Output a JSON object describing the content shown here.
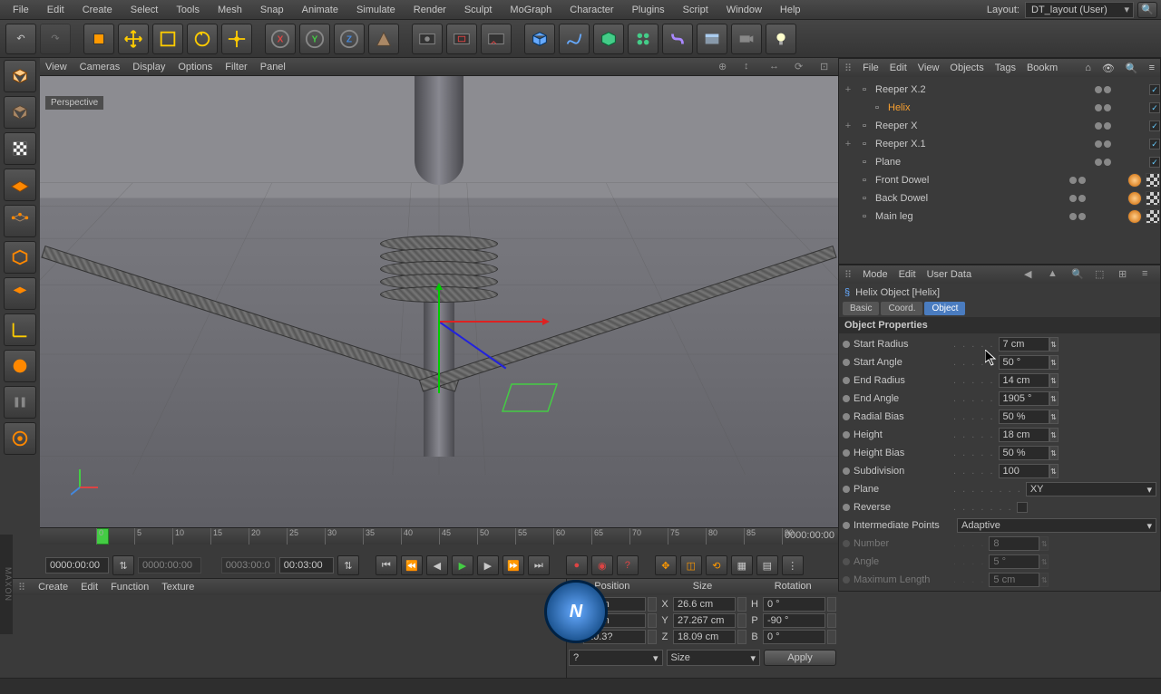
{
  "menubar": [
    "File",
    "Edit",
    "Create",
    "Select",
    "Tools",
    "Mesh",
    "Snap",
    "Animate",
    "Simulate",
    "Render",
    "Sculpt",
    "MoGraph",
    "Character",
    "Plugins",
    "Script",
    "Window",
    "Help"
  ],
  "layout": {
    "label": "Layout:",
    "value": "DT_layout (User)"
  },
  "obj_menu": [
    "File",
    "Edit",
    "View",
    "Objects",
    "Tags",
    "Bookm"
  ],
  "vp_menu": [
    "View",
    "Cameras",
    "Display",
    "Options",
    "Filter",
    "Panel"
  ],
  "vp_label": "Perspective",
  "tree": [
    {
      "name": "Reeper X.2",
      "exp": "+",
      "indent": 0,
      "sel": false,
      "chk": true
    },
    {
      "name": "Helix",
      "exp": "",
      "indent": 1,
      "sel": true,
      "chk": true
    },
    {
      "name": "Reeper X",
      "exp": "+",
      "indent": 0,
      "sel": false,
      "chk": true
    },
    {
      "name": "Reeper X.1",
      "exp": "+",
      "indent": 0,
      "sel": false,
      "chk": true
    },
    {
      "name": "Plane",
      "exp": "",
      "indent": 0,
      "sel": false,
      "chk": true
    },
    {
      "name": "Front Dowel",
      "exp": "",
      "indent": 0,
      "sel": false,
      "chk": false,
      "tags": [
        "orange",
        "checker"
      ]
    },
    {
      "name": "Back Dowel",
      "exp": "",
      "indent": 0,
      "sel": false,
      "chk": false,
      "tags": [
        "orange",
        "checker"
      ]
    },
    {
      "name": "Main leg",
      "exp": "",
      "indent": 0,
      "sel": false,
      "chk": false,
      "tags": [
        "orange",
        "checker"
      ]
    }
  ],
  "attr_menu": [
    "Mode",
    "Edit",
    "User Data"
  ],
  "attr_title": "Helix Object [Helix]",
  "attr_tabs": [
    {
      "label": "Basic",
      "active": false
    },
    {
      "label": "Coord.",
      "active": false
    },
    {
      "label": "Object",
      "active": true
    }
  ],
  "section": "Object Properties",
  "props": [
    {
      "label": "Start Radius",
      "value": "7 cm",
      "dim": false
    },
    {
      "label": "Start Angle",
      "value": "50 °",
      "dim": false
    },
    {
      "label": "End Radius",
      "value": "14 cm",
      "dim": false
    },
    {
      "label": "End Angle",
      "value": "1905 °",
      "dim": false
    },
    {
      "label": "Radial Bias",
      "value": "50 %",
      "dim": false
    },
    {
      "label": "Height",
      "value": "18 cm",
      "dim": false
    },
    {
      "label": "Height Bias",
      "value": "50 %",
      "dim": false
    },
    {
      "label": "Subdivision",
      "value": "100",
      "dim": false
    }
  ],
  "plane_dd": "XY",
  "reverse_label": "Reverse",
  "plane_label": "Plane",
  "interp_label": "Intermediate Points",
  "interp_value": "Adaptive",
  "dim_props": [
    {
      "label": "Number",
      "value": "8"
    },
    {
      "label": "Angle",
      "value": "5 °"
    },
    {
      "label": "Maximum Length",
      "value": "5 cm"
    }
  ],
  "timeline": {
    "ticks": [
      "0",
      "5",
      "10",
      "15",
      "20",
      "25",
      "30",
      "35",
      "40",
      "45",
      "50",
      "55",
      "60",
      "65",
      "70",
      "75",
      "80",
      "85",
      "90"
    ],
    "end": "0000:00:00",
    "frame_a": "0000:00:00",
    "frame_b": "0000:00:00",
    "frame_c": "0003:00:0",
    "frame_d": "00:03:00"
  },
  "mat_menu": [
    "Create",
    "Edit",
    "Function",
    "Texture"
  ],
  "coord": {
    "heads": [
      "Position",
      "Size",
      "Rotation"
    ],
    "rows": [
      {
        "a": "X",
        "pv": "0 cm",
        "sv": "26.6 cm",
        "ra": "H",
        "rv": "0 °"
      },
      {
        "a": "Y",
        "pv": "? cm",
        "sv": "27.267 cm",
        "ra": "P",
        "rv": "-90 °"
      },
      {
        "a": "Z",
        "pv": "10.3?",
        "sv": "18.09 cm",
        "ra": "B",
        "rv": "0 °"
      }
    ],
    "dd1": "?",
    "dd2": "Size",
    "apply": "Apply"
  },
  "logo_text": "MAXON"
}
